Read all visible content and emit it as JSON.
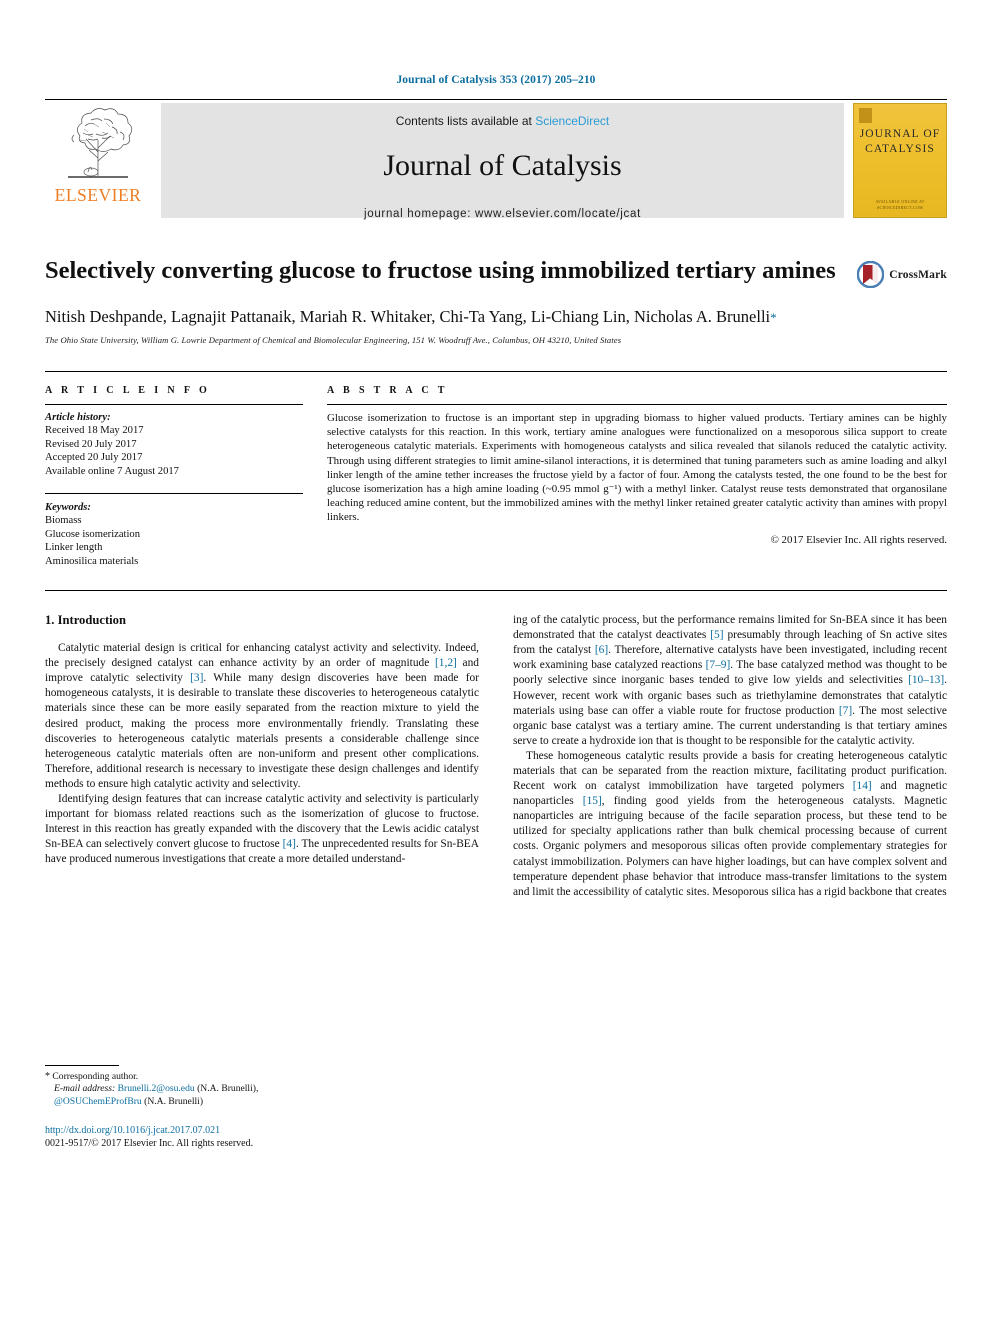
{
  "running_head": "Journal of Catalysis 353 (2017) 205–210",
  "masthead": {
    "contents_prefix": "Contents lists available at ",
    "sciencedirect": "ScienceDirect",
    "journal_name": "Journal of Catalysis",
    "homepage": "journal homepage: www.elsevier.com/locate/jcat",
    "publisher_wordmark": "ELSEVIER",
    "cover_title_line1": "JOURNAL OF",
    "cover_title_line2": "CATALYSIS",
    "cover_footer": "AVAILABLE ONLINE AT SCIENCEDIRECT.COM",
    "accent_blue": "#2b9bd4",
    "elsevier_orange": "#ef7d22",
    "cover_yellow": "#eebe2a"
  },
  "article": {
    "title": "Selectively converting glucose to fructose using immobilized tertiary amines",
    "crossmark_label": "CrossMark",
    "authors": "Nitish Deshpande, Lagnajit Pattanaik, Mariah R. Whitaker, Chi-Ta Yang, Li-Chiang Lin, Nicholas A. Brunelli",
    "corresponding_marker": "*",
    "affiliation": "The Ohio State University, William G. Lowrie Department of Chemical and Biomolecular Engineering, 151 W. Woodruff Ave., Columbus, OH 43210, United States"
  },
  "article_info": {
    "heading": "A R T I C L E    I N F O",
    "history_label": "Article history:",
    "history": [
      "Received 18 May 2017",
      "Revised 20 July 2017",
      "Accepted 20 July 2017",
      "Available online 7 August 2017"
    ],
    "keywords_label": "Keywords:",
    "keywords": [
      "Biomass",
      "Glucose isomerization",
      "Linker length",
      "Aminosilica materials"
    ]
  },
  "abstract": {
    "heading": "A B S T R A C T",
    "text": "Glucose isomerization to fructose is an important step in upgrading biomass to higher valued products. Tertiary amines can be highly selective catalysts for this reaction. In this work, tertiary amine analogues were functionalized on a mesoporous silica support to create heterogeneous catalytic materials. Experiments with homogeneous catalysts and silica revealed that silanols reduced the catalytic activity. Through using different strategies to limit amine-silanol interactions, it is determined that tuning parameters such as amine loading and alkyl linker length of the amine tether increases the fructose yield by a factor of four. Among the catalysts tested, the one found to be the best for glucose isomerization has a high amine loading (~0.95 mmol g⁻¹) with a methyl linker. Catalyst reuse tests demonstrated that organosilane leaching reduced amine content, but the immobilized amines with the methyl linker retained greater catalytic activity than amines with propyl linkers.",
    "copyright": "© 2017 Elsevier Inc. All rights reserved."
  },
  "body": {
    "section_title": "1. Introduction",
    "left_paragraphs": [
      "Catalytic material design is critical for enhancing catalyst activity and selectivity. Indeed, the precisely designed catalyst can enhance activity by an order of magnitude [1,2] and improve catalytic selectivity [3]. While many design discoveries have been made for homogeneous catalysts, it is desirable to translate these discoveries to heterogeneous catalytic materials since these can be more easily separated from the reaction mixture to yield the desired product, making the process more environmentally friendly. Translating these discoveries to heterogeneous catalytic materials presents a considerable challenge since heterogeneous catalytic materials often are non-uniform and present other complications. Therefore, additional research is necessary to investigate these design challenges and identify methods to ensure high catalytic activity and selectivity.",
      "Identifying design features that can increase catalytic activity and selectivity is particularly important for biomass related reactions such as the isomerization of glucose to fructose. Interest in this reaction has greatly expanded with the discovery that the Lewis acidic catalyst Sn-BEA can selectively convert glucose to fructose [4]. The unprecedented results for Sn-BEA have produced numerous investigations that create a more detailed understand-"
    ],
    "right_paragraphs": [
      "ing of the catalytic process, but the performance remains limited for Sn-BEA since it has been demonstrated that the catalyst deactivates [5] presumably through leaching of Sn active sites from the catalyst [6]. Therefore, alternative catalysts have been investigated, including recent work examining base catalyzed reactions [7–9]. The base catalyzed method was thought to be poorly selective since inorganic bases tended to give low yields and selectivities [10–13]. However, recent work with organic bases such as triethylamine demonstrates that catalytic materials using base can offer a viable route for fructose production [7]. The most selective organic base catalyst was a tertiary amine. The current understanding is that tertiary amines serve to create a hydroxide ion that is thought to be responsible for the catalytic activity.",
      "These homogeneous catalytic results provide a basis for creating heterogeneous catalytic materials that can be separated from the reaction mixture, facilitating product purification. Recent work on catalyst immobilization have targeted polymers [14] and magnetic nanoparticles [15], finding good yields from the heterogeneous catalysts. Magnetic nanoparticles are intriguing because of the facile separation process, but these tend to be utilized for specialty applications rather than bulk chemical processing because of current costs. Organic polymers and mesoporous silicas often provide complementary strategies for catalyst immobilization. Polymers can have higher loadings, but can have complex solvent and temperature dependent phase behavior that introduce mass-transfer limitations to the system and limit the accessibility of catalytic sites. Mesoporous silica has a rigid backbone that creates"
    ]
  },
  "footnote": {
    "corresponding_star": "*",
    "corresponding_text": "Corresponding author.",
    "email_label": "E-mail address:",
    "email": "Brunelli.2@osu.edu",
    "email_owner": "(N.A. Brunelli),",
    "handle": "@OSUChemEProfBru",
    "handle_owner": "(N.A. Brunelli)",
    "doi": "http://dx.doi.org/10.1016/j.jcat.2017.07.021",
    "issn": "0021-9517/© 2017 Elsevier Inc. All rights reserved."
  }
}
